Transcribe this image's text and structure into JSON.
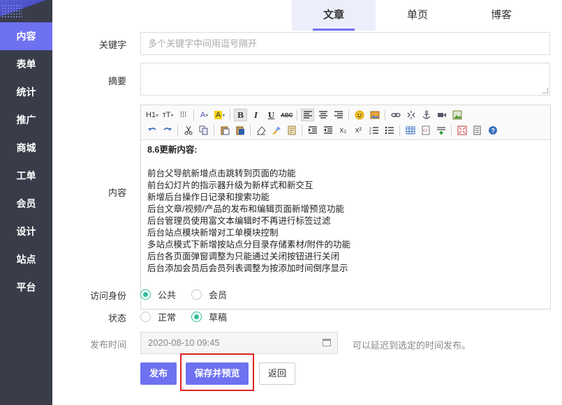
{
  "sidebar": {
    "items": [
      {
        "label": "内容",
        "active": true
      },
      {
        "label": "表单"
      },
      {
        "label": "统计"
      },
      {
        "label": "推广"
      },
      {
        "label": "商城"
      },
      {
        "label": "工单"
      },
      {
        "label": "会员"
      },
      {
        "label": "设计"
      },
      {
        "label": "站点"
      },
      {
        "label": "平台"
      }
    ]
  },
  "tabs": [
    {
      "label": "文章",
      "active": true
    },
    {
      "label": "单页"
    },
    {
      "label": "博客"
    }
  ],
  "form": {
    "keywords": {
      "label": "关键字",
      "placeholder": "多个关键字中间用逗号隔开"
    },
    "summary": {
      "label": "摘要"
    },
    "content": {
      "label": "内容"
    },
    "access": {
      "label": "访问身份",
      "options": [
        "公共",
        "会员"
      ],
      "selected": "公共"
    },
    "status": {
      "label": "状态",
      "options": [
        "正常",
        "草稿"
      ],
      "selected": "草稿"
    },
    "publish_time": {
      "label": "发布时间",
      "value": "2020-08-10 09:45",
      "hint": "可以延迟到选定的时间发布。"
    }
  },
  "editor": {
    "toolbar_text": {
      "heading": "H1",
      "font_size": "тT",
      "font_color": "A",
      "bg_color": "A",
      "bold": "B",
      "italic": "I",
      "underline": "U",
      "strike": "ABC",
      "subscript": "x₂",
      "superscript": "x²"
    },
    "heading": "8.6更新内容:",
    "lines": [
      "前台父导航新增点击跳转到页面的功能",
      "前台幻灯片的指示器升级为新样式和新交互",
      "新增后台操作日记录和搜索功能",
      "后台文章/视频/产品的发布和编辑页面新增预览功能",
      "后台管理员使用富文本编辑时不再进行标签过滤",
      "后台站点模块新增对工单模块控制",
      "多站点模式下新增按站点分目录存储素材/附件的功能",
      "后台各页面弹窗调整为只能通过关闭按钮进行关闭",
      "后台添加会员后会员列表调整为按添加时间倒序显示"
    ]
  },
  "buttons": {
    "publish": "发布",
    "save_preview": "保存并预览",
    "back": "返回"
  },
  "colors": {
    "accent": "#6e71f0",
    "sidebar": "#393d49",
    "radio": "#2fbf9b",
    "highlight": "#e02020"
  }
}
